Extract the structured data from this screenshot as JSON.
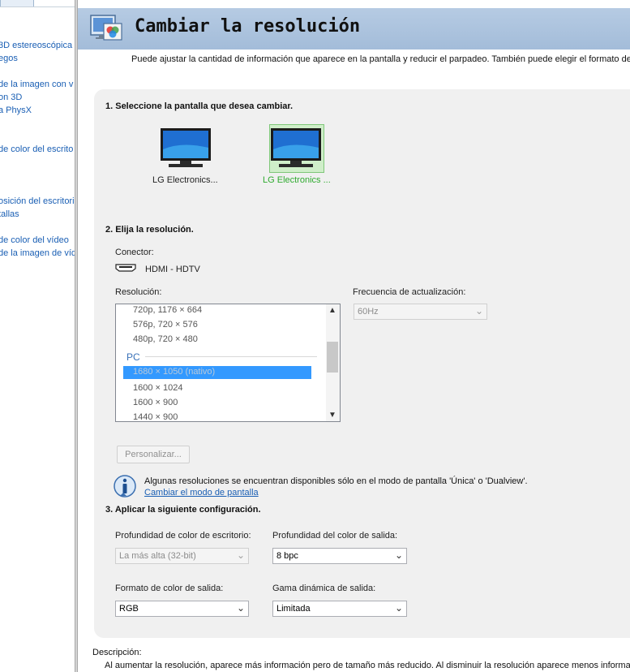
{
  "sidebar": {
    "items": [
      {
        "line1": "3D estereoscópica",
        "line2": "egos"
      },
      {
        "line1": "de la imagen con v",
        "line2": "on 3D",
        "line3": "a PhysX"
      },
      {
        "line1": "de color del escrito"
      },
      {
        "line1": "osición del escritorio",
        "line2": "tallas"
      },
      {
        "line1": "de color del vídeo",
        "line2": "de la imagen de víd"
      }
    ]
  },
  "header": {
    "title": "Cambiar la resolución"
  },
  "intro": "Puede ajustar la cantidad de información que aparece en la pantalla y reducir el parpadeo. También puede elegir el formato de alta",
  "step1": {
    "heading": "1. Seleccione la pantalla que desea cambiar.",
    "monitors": [
      {
        "label": "LG Electronics...",
        "selected": false
      },
      {
        "label": "LG Electronics ...",
        "selected": true
      }
    ]
  },
  "step2": {
    "heading": "2. Elija la resolución.",
    "connector_label": "Conector:",
    "connector_value": "HDMI - HDTV",
    "resolution_label": "Resolución:",
    "resolutions_top": [
      "720p, 1176 × 664",
      "576p, 720 × 576",
      "480p, 720 × 480"
    ],
    "group_label": "PC",
    "selected_resolution": "1680 × 1050 (nativo)",
    "resolutions_bottom": [
      "1600 × 1024",
      "1600 × 900",
      "1440 × 900"
    ],
    "refresh_label": "Frecuencia de actualización:",
    "refresh_value": "60Hz",
    "customize_button": "Personalizar...",
    "info_text": "Algunas resoluciones se encuentran disponibles sólo en el modo de pantalla 'Única' o 'Dualview'.",
    "info_link": "Cambiar el modo de pantalla"
  },
  "step3": {
    "heading": "3. Aplicar la siguiente configuración.",
    "desktop_depth_label": "Profundidad de color de escritorio:",
    "desktop_depth_value": "La más alta (32-bit)",
    "output_depth_label": "Profundidad del color de salida:",
    "output_depth_value": "8 bpc",
    "output_format_label": "Formato de color de salida:",
    "output_format_value": "RGB",
    "dynamic_range_label": "Gama dinámica de salida:",
    "dynamic_range_value": "Limitada"
  },
  "description": {
    "label": "Descripción:",
    "text": "Al aumentar la resolución, aparece más información pero de tamaño más reducido. Al disminuir la resolución aparece menos información"
  },
  "colors": {
    "accent": "#1a5fb4",
    "selection": "#3399ff",
    "selected_monitor_label": "#2eaa2e",
    "header": "#a9c1dc"
  }
}
